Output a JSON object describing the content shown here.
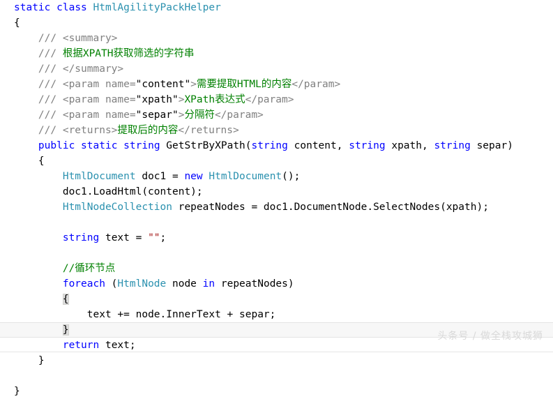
{
  "editor": {
    "language": "C#",
    "theme": "visual-studio-light",
    "background_color": "#ffffff",
    "colors": {
      "keyword": "#0000FF",
      "type": "#2B91AF",
      "string": "#A31515",
      "comment": "#008000",
      "xml_doc_delimiter": "#808080",
      "plain_text": "#000000",
      "brace_match_highlight": "#DCDCDC",
      "current_line_highlight": "#F7F7F7"
    }
  },
  "code": {
    "lines": [
      {
        "id": "line-1",
        "indent": 0,
        "tokens": [
          {
            "t": "kw",
            "s": "static"
          },
          {
            "t": "pln",
            "s": " "
          },
          {
            "t": "kw",
            "s": "class"
          },
          {
            "t": "pln",
            "s": " "
          },
          {
            "t": "typ",
            "s": "HtmlAgilityPackHelper"
          }
        ]
      },
      {
        "id": "line-2",
        "indent": 0,
        "tokens": [
          {
            "t": "pln",
            "s": "{"
          }
        ]
      },
      {
        "id": "line-3",
        "indent": 1,
        "tokens": [
          {
            "t": "xdoc",
            "s": "/// <summary>"
          }
        ]
      },
      {
        "id": "line-4",
        "indent": 1,
        "tokens": [
          {
            "t": "xdoc",
            "s": "/// "
          },
          {
            "t": "cmt",
            "s": "根据XPATH获取筛选的字符串"
          }
        ]
      },
      {
        "id": "line-5",
        "indent": 1,
        "tokens": [
          {
            "t": "xdoc",
            "s": "/// </summary>"
          }
        ]
      },
      {
        "id": "line-6",
        "indent": 1,
        "tokens": [
          {
            "t": "xdoc",
            "s": "/// <param name="
          },
          {
            "t": "xatt",
            "s": "\"content\""
          },
          {
            "t": "xdoc",
            "s": ">"
          },
          {
            "t": "cmt",
            "s": "需要提取HTML的内容"
          },
          {
            "t": "xdoc",
            "s": "</param>"
          }
        ]
      },
      {
        "id": "line-7",
        "indent": 1,
        "tokens": [
          {
            "t": "xdoc",
            "s": "/// <param name="
          },
          {
            "t": "xatt",
            "s": "\"xpath\""
          },
          {
            "t": "xdoc",
            "s": ">"
          },
          {
            "t": "cmt",
            "s": "XPath表达式"
          },
          {
            "t": "xdoc",
            "s": "</param>"
          }
        ]
      },
      {
        "id": "line-8",
        "indent": 1,
        "tokens": [
          {
            "t": "xdoc",
            "s": "/// <param name="
          },
          {
            "t": "xatt",
            "s": "\"separ\""
          },
          {
            "t": "xdoc",
            "s": ">"
          },
          {
            "t": "cmt",
            "s": "分隔符"
          },
          {
            "t": "xdoc",
            "s": "</param>"
          }
        ]
      },
      {
        "id": "line-9",
        "indent": 1,
        "tokens": [
          {
            "t": "xdoc",
            "s": "/// <returns>"
          },
          {
            "t": "cmt",
            "s": "提取后的内容"
          },
          {
            "t": "xdoc",
            "s": "</returns>"
          }
        ]
      },
      {
        "id": "line-10",
        "indent": 1,
        "tokens": [
          {
            "t": "kw",
            "s": "public"
          },
          {
            "t": "pln",
            "s": " "
          },
          {
            "t": "kw",
            "s": "static"
          },
          {
            "t": "pln",
            "s": " "
          },
          {
            "t": "kw",
            "s": "string"
          },
          {
            "t": "pln",
            "s": " GetStrByXPath("
          },
          {
            "t": "kw",
            "s": "string"
          },
          {
            "t": "pln",
            "s": " content, "
          },
          {
            "t": "kw",
            "s": "string"
          },
          {
            "t": "pln",
            "s": " xpath, "
          },
          {
            "t": "kw",
            "s": "string"
          },
          {
            "t": "pln",
            "s": " separ)"
          }
        ]
      },
      {
        "id": "line-11",
        "indent": 1,
        "tokens": [
          {
            "t": "pln",
            "s": "{"
          }
        ]
      },
      {
        "id": "line-12",
        "indent": 2,
        "tokens": [
          {
            "t": "typ",
            "s": "HtmlDocument"
          },
          {
            "t": "pln",
            "s": " doc1 = "
          },
          {
            "t": "kw",
            "s": "new"
          },
          {
            "t": "pln",
            "s": " "
          },
          {
            "t": "typ",
            "s": "HtmlDocument"
          },
          {
            "t": "pln",
            "s": "();"
          }
        ]
      },
      {
        "id": "line-13",
        "indent": 2,
        "tokens": [
          {
            "t": "pln",
            "s": "doc1.LoadHtml(content);"
          }
        ]
      },
      {
        "id": "line-14",
        "indent": 2,
        "tokens": [
          {
            "t": "typ",
            "s": "HtmlNodeCollection"
          },
          {
            "t": "pln",
            "s": " repeatNodes = doc1.DocumentNode.SelectNodes(xpath);"
          }
        ]
      },
      {
        "id": "line-15",
        "indent": 0,
        "tokens": []
      },
      {
        "id": "line-16",
        "indent": 2,
        "tokens": [
          {
            "t": "kw",
            "s": "string"
          },
          {
            "t": "pln",
            "s": " text = "
          },
          {
            "t": "str",
            "s": "\"\""
          },
          {
            "t": "pln",
            "s": ";"
          }
        ]
      },
      {
        "id": "line-17",
        "indent": 0,
        "tokens": []
      },
      {
        "id": "line-18",
        "indent": 2,
        "tokens": [
          {
            "t": "cmt",
            "s": "//循环节点"
          }
        ]
      },
      {
        "id": "line-19",
        "indent": 2,
        "tokens": [
          {
            "t": "kw",
            "s": "foreach"
          },
          {
            "t": "pln",
            "s": " ("
          },
          {
            "t": "typ",
            "s": "HtmlNode"
          },
          {
            "t": "pln",
            "s": " node "
          },
          {
            "t": "kw",
            "s": "in"
          },
          {
            "t": "pln",
            "s": " repeatNodes)"
          }
        ]
      },
      {
        "id": "line-20",
        "indent": 2,
        "brace_match": true,
        "tokens": [
          {
            "t": "pln",
            "s": "{",
            "hl": true
          }
        ]
      },
      {
        "id": "line-21",
        "indent": 3,
        "tokens": [
          {
            "t": "pln",
            "s": "text += node.InnerText + separ;"
          }
        ]
      },
      {
        "id": "line-22",
        "indent": 2,
        "current_line": true,
        "brace_match": true,
        "tokens": [
          {
            "t": "pln",
            "s": "}",
            "hl": true
          }
        ]
      },
      {
        "id": "line-23",
        "indent": 2,
        "tokens": [
          {
            "t": "kw",
            "s": "return"
          },
          {
            "t": "pln",
            "s": " text;"
          }
        ]
      },
      {
        "id": "line-24",
        "indent": 1,
        "tokens": [
          {
            "t": "pln",
            "s": "}"
          }
        ]
      },
      {
        "id": "line-25",
        "indent": 0,
        "tokens": []
      },
      {
        "id": "line-26",
        "indent": 0,
        "tokens": [
          {
            "t": "pln",
            "s": "}"
          }
        ]
      }
    ]
  },
  "watermark": {
    "text": "头条号 / 做全栈攻城狮"
  }
}
